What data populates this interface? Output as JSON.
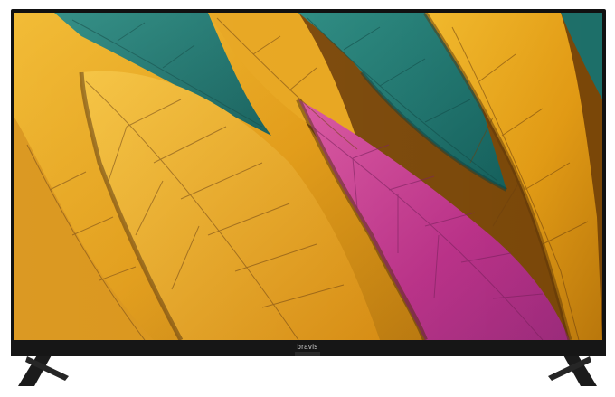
{
  "product": {
    "brand_label": "bravis"
  },
  "colors": {
    "bezel": "#111111",
    "stand": "#1b1b1b",
    "leaf_gold": "#e9a71b",
    "leaf_teal": "#1f7a73",
    "leaf_magenta": "#c23a93",
    "vein": "#6b3e0c"
  }
}
